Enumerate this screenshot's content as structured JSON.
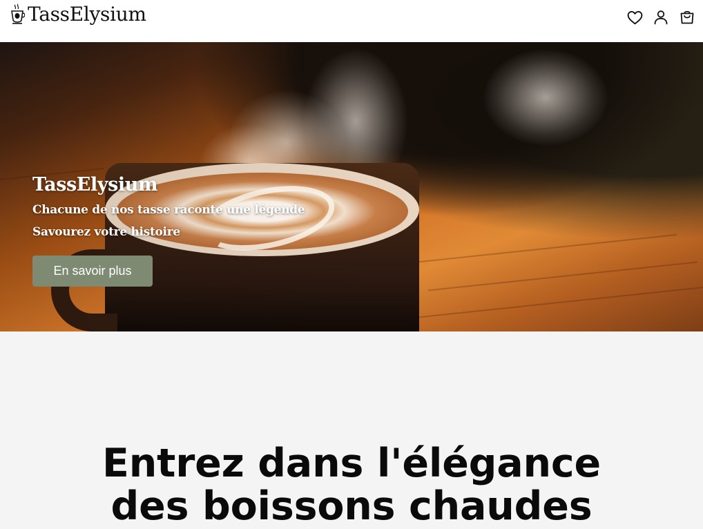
{
  "header": {
    "brand": "TassElysium",
    "icons": {
      "wishlist": "heart-icon",
      "account": "user-icon",
      "cart": "shopping-bag-icon"
    }
  },
  "hero": {
    "title": "TassElysium",
    "tagline_1": "Chacune de nos tasse raconte une légende",
    "tagline_2": "Savourez votre histoire",
    "cta_label": "En savoir plus",
    "cta_color": "#7f8a73"
  },
  "section": {
    "headline_line_1": "Entrez dans l'élégance",
    "headline_line_2": "des boissons chaudes"
  }
}
